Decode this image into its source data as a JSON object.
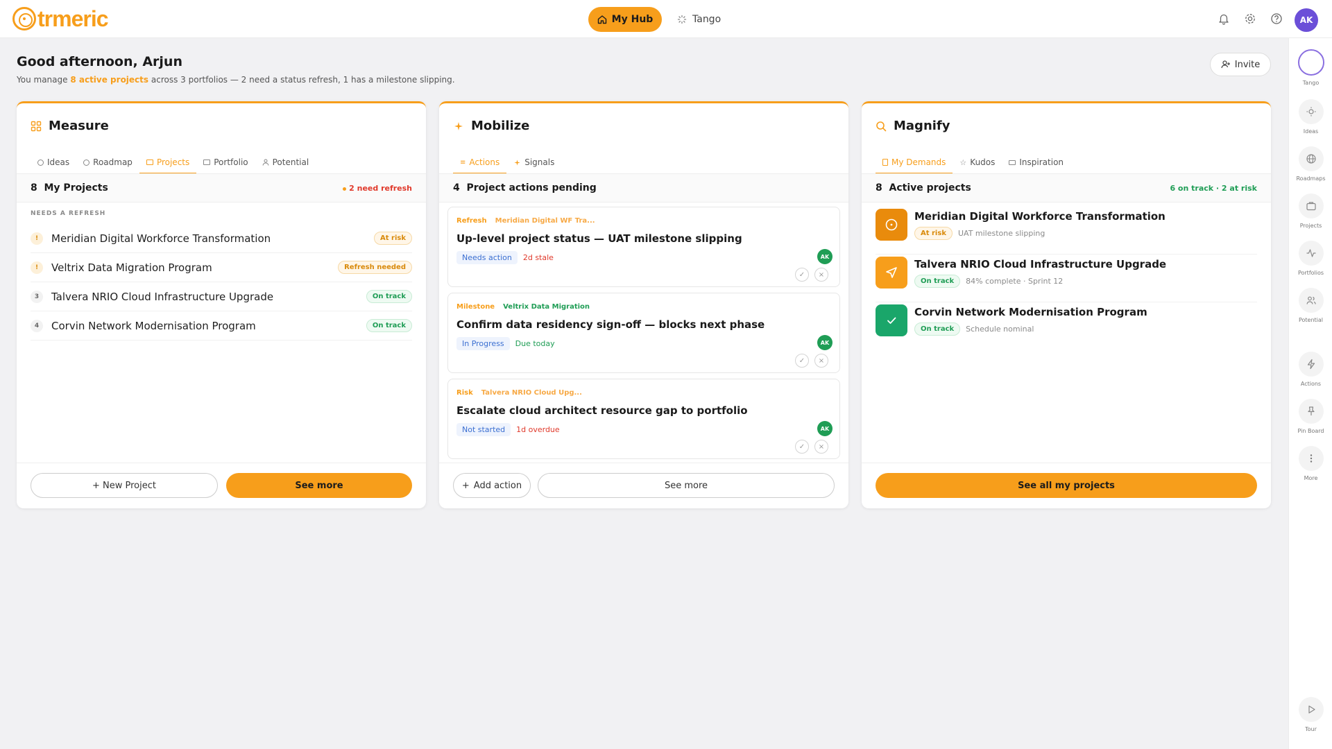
{
  "nav": {
    "brand": "trmeric",
    "hub_label": "My Hub",
    "tango_label": "Tango",
    "avatar": "AK",
    "icons": [
      "bell-icon",
      "gear-icon",
      "help-icon"
    ]
  },
  "greeting": {
    "title": "Good afternoon, Arjun",
    "pre": "You manage ",
    "highlight": "8 active projects",
    "post": " across 3 portfolios — 2 need a status refresh, 1 has a milestone slipping.",
    "invite": "Invite"
  },
  "measure": {
    "title": "Measure",
    "tabs": [
      "Ideas",
      "Roadmap",
      "Projects",
      "Portfolio",
      "Potential"
    ],
    "bar_count": "8",
    "bar_title": "My Projects",
    "bar_right": "2 need refresh",
    "section_label": "NEEDS A REFRESH",
    "projects": [
      {
        "num": "!",
        "name": "Meridian Digital Workforce Transformation",
        "status": "At risk"
      },
      {
        "num": "!",
        "name": "Veltrix Data Migration Program",
        "status": "Refresh needed"
      },
      {
        "num": "3",
        "name": "Talvera NRIO Cloud Infrastructure Upgrade",
        "status": "On track"
      },
      {
        "num": "4",
        "name": "Corvin Network Modernisation Program",
        "status": "On track"
      }
    ],
    "new_project": "+ New Project",
    "see_more": "See more"
  },
  "mobilize": {
    "title": "Mobilize",
    "tabs": [
      "Actions",
      "Signals"
    ],
    "bar_count": "4",
    "bar_title": "Project actions pending",
    "actions": [
      {
        "tag": "Refresh",
        "project": "Meridian Digital WF Tra...",
        "title": "Up-level project status — UAT milestone slipping",
        "status": "Needs action",
        "due": "2d stale",
        "avatar": "AK"
      },
      {
        "tag": "Milestone",
        "project": "Veltrix Data Migration",
        "title": "Confirm data residency sign-off — blocks next phase",
        "status": "In Progress",
        "due": "Due today",
        "avatar": "AK"
      },
      {
        "tag": "Risk",
        "project": "Talvera NRIO Cloud Upg...",
        "title": "Escalate cloud architect resource gap to portfolio",
        "status": "Not started",
        "due": "1d overdue",
        "avatar": "AK"
      }
    ],
    "add_action": "Add action",
    "see_more": "See more"
  },
  "magnify": {
    "title": "Magnify",
    "tabs": [
      "My Demands",
      "Kudos",
      "Inspiration"
    ],
    "bar_count": "8",
    "bar_title": "Active projects",
    "bar_right": "6 on track · 2 at risk",
    "projects": [
      {
        "name": "Meridian Digital Workforce Transformation",
        "status": "At risk",
        "meta": "UAT milestone slipping"
      },
      {
        "name": "Talvera NRIO Cloud Infrastructure Upgrade",
        "status": "On track",
        "meta": "84% complete · Sprint 12"
      },
      {
        "name": "Corvin Network Modernisation Program",
        "status": "On track",
        "meta": "Schedule nominal"
      }
    ],
    "see_all": "See all my projects"
  },
  "rail": {
    "items": [
      "Tango",
      "Ideas",
      "Roadmaps",
      "Projects",
      "Portfolios",
      "Potential",
      "Actions",
      "Pin Board",
      "More"
    ],
    "tour": "Tour"
  },
  "colors": {
    "accent": "#f79e1b",
    "green": "#1f9d55",
    "red": "#e0392b",
    "blue": "#3b6fd1"
  }
}
